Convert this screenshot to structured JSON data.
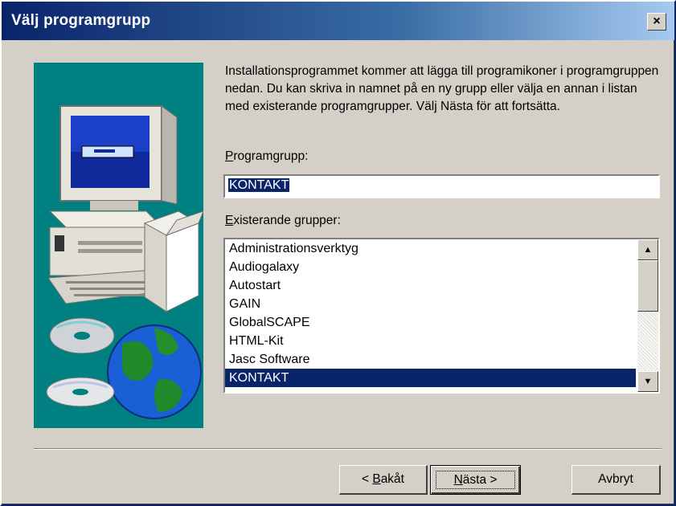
{
  "window": {
    "title": "Välj programgrupp",
    "close_label": "×"
  },
  "intro_text": "Installationsprogrammet kommer att lägga till programikoner i programgruppen nedan. Du kan skriva in namnet på en ny grupp eller välja en annan i listan med existerande programgrupper. Välj Nästa för att fortsätta.",
  "program_group": {
    "label_accel": "P",
    "label_rest": "rogramgrupp:",
    "value": "KONTAKT"
  },
  "existing_groups": {
    "label_accel": "E",
    "label_rest": "xisterande grupper:",
    "items": [
      "Administrationsverktyg",
      "Audiogalaxy",
      "Autostart",
      "GAIN",
      "GlobalSCAPE",
      "HTML-Kit",
      "Jasc Software",
      "KONTAKT"
    ],
    "selected": "KONTAKT"
  },
  "buttons": {
    "back_prefix": "< ",
    "back_accel": "B",
    "back_rest": "akåt",
    "next_accel": "N",
    "next_rest": "ästa >",
    "cancel": "Avbryt"
  },
  "colors": {
    "titlebar_start": "#0a246a",
    "selection": "#0a246a",
    "illustration_bg": "#008080",
    "dialog_bg": "#d4d0c8"
  }
}
